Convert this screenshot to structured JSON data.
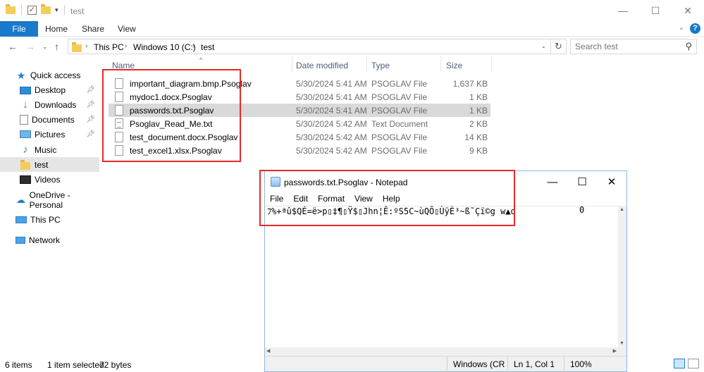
{
  "explorer": {
    "title": "test",
    "window_controls": {
      "minimize": "—",
      "maximize": "☐",
      "close": "✕"
    },
    "ribbon": {
      "file": "File",
      "tabs": [
        "Home",
        "Share",
        "View"
      ]
    },
    "address": {
      "crumbs": [
        "This PC",
        "Windows 10 (C:)",
        "test"
      ]
    },
    "search": {
      "placeholder": "Search test"
    },
    "nav": {
      "quick_access": "Quick access",
      "items": [
        {
          "label": "Desktop",
          "pinned": true
        },
        {
          "label": "Downloads",
          "pinned": true
        },
        {
          "label": "Documents",
          "pinned": true
        },
        {
          "label": "Pictures",
          "pinned": true
        },
        {
          "label": "Music",
          "pinned": false
        },
        {
          "label": "test",
          "pinned": false,
          "selected": true
        },
        {
          "label": "Videos",
          "pinned": false
        }
      ],
      "onedrive": "OneDrive - Personal",
      "this_pc": "This PC",
      "network": "Network"
    },
    "columns": {
      "name": "Name",
      "date": "Date modified",
      "type": "Type",
      "size": "Size"
    },
    "files": [
      {
        "name": "important_diagram.bmp.Psoglav",
        "date": "5/30/2024 5:41 AM",
        "type": "PSOGLAV File",
        "size": "1,637 KB",
        "selected": false,
        "icon": "file-icon"
      },
      {
        "name": "mydoc1.docx.Psoglav",
        "date": "5/30/2024 5:41 AM",
        "type": "PSOGLAV File",
        "size": "1 KB",
        "selected": false,
        "icon": "file-icon"
      },
      {
        "name": "passwords.txt.Psoglav",
        "date": "5/30/2024 5:41 AM",
        "type": "PSOGLAV File",
        "size": "1 KB",
        "selected": true,
        "icon": "file-icon"
      },
      {
        "name": "Psoglav_Read_Me.txt",
        "date": "5/30/2024 5:42 AM",
        "type": "Text Document",
        "size": "2 KB",
        "selected": false,
        "icon": "text-file-icon"
      },
      {
        "name": "test_document.docx.Psoglav",
        "date": "5/30/2024 5:42 AM",
        "type": "PSOGLAV File",
        "size": "14 KB",
        "selected": false,
        "icon": "file-icon"
      },
      {
        "name": "test_excel1.xlsx.Psoglav",
        "date": "5/30/2024 5:42 AM",
        "type": "PSOGLAV File",
        "size": "9 KB",
        "selected": false,
        "icon": "file-icon"
      }
    ],
    "status": {
      "items": "6 items",
      "selected": "1 item selected",
      "size": "72 bytes"
    }
  },
  "notepad": {
    "title": "passwords.txt.Psoglav - Notepad",
    "menu": [
      "File",
      "Edit",
      "Format",
      "View",
      "Help"
    ],
    "content": "ﾌ%+ªû$QÉ=ë>p▯‡¶▯Ÿ$▯Jhn¦Ê:ºS5C~ùQÕ▯ÙÿÈ³~ß˜Çï©g w▲o",
    "content_right": "0",
    "status": {
      "encoding": "Windows (CRLF",
      "position": "Ln 1, Col 1",
      "zoom": "100%"
    }
  }
}
